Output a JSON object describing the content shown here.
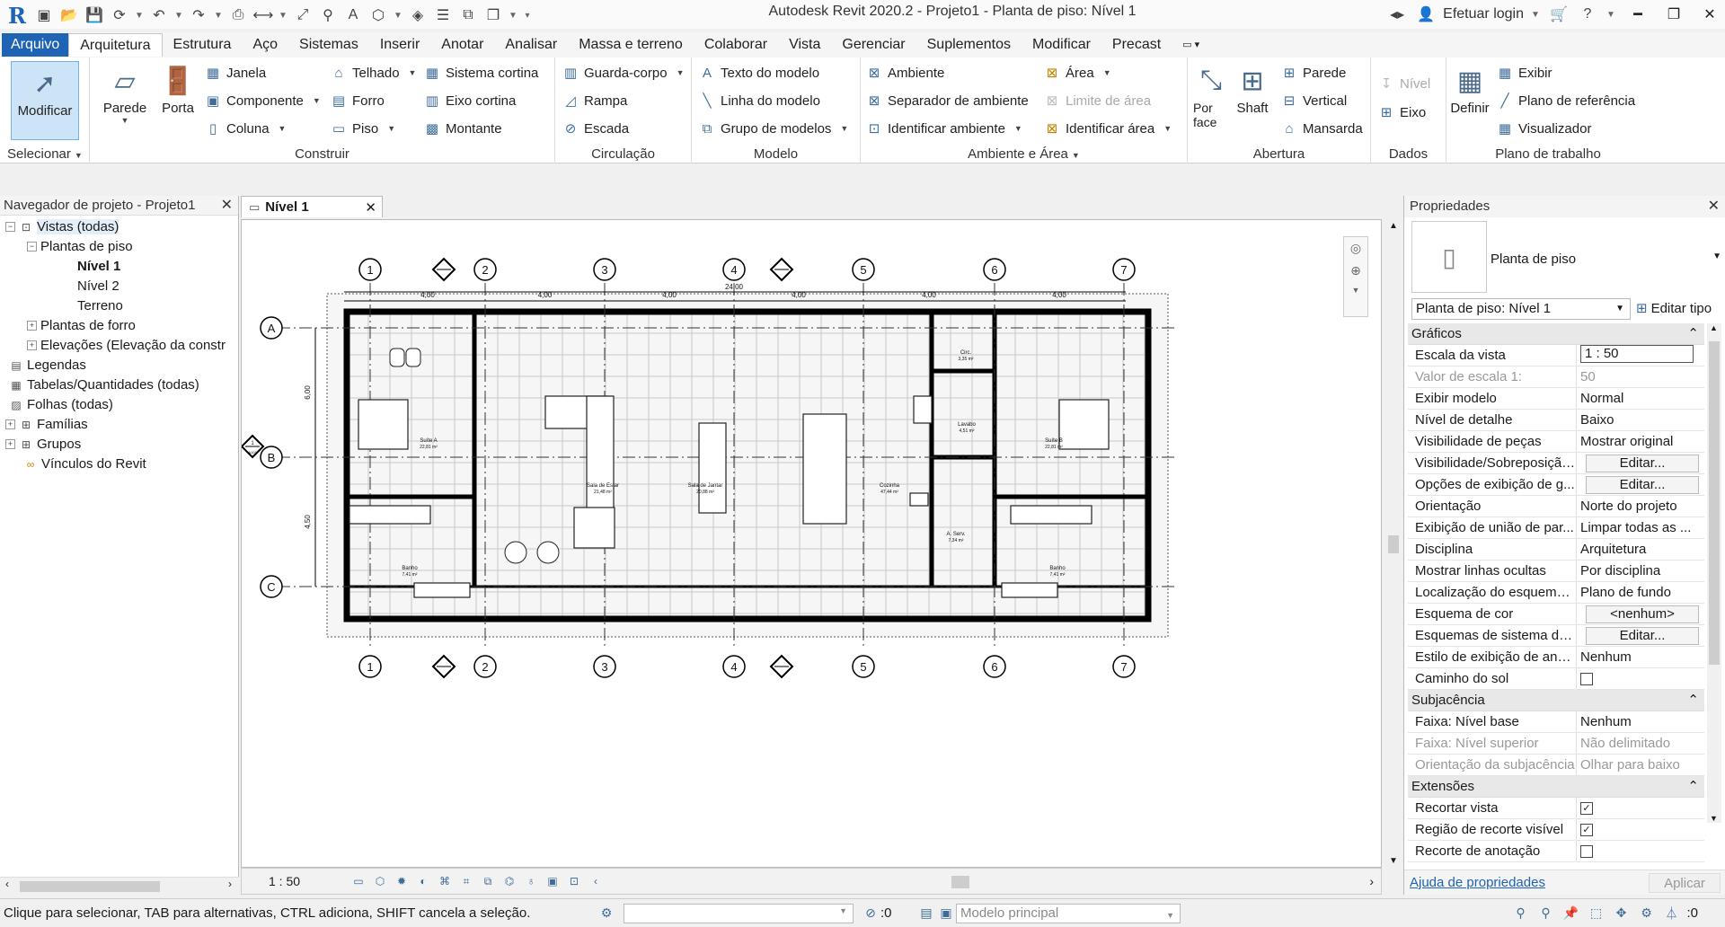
{
  "window": {
    "title": "Autodesk Revit 2020.2 - Projeto1 - Planta de piso: Nível 1",
    "login": "Efetuar login"
  },
  "menu_tabs": [
    "Arquivo",
    "Arquitetura",
    "Estrutura",
    "Aço",
    "Sistemas",
    "Inserir",
    "Anotar",
    "Analisar",
    "Massa e terreno",
    "Colaborar",
    "Vista",
    "Gerenciar",
    "Suplementos",
    "Modificar",
    "Precast"
  ],
  "ribbon": {
    "selecionar": {
      "button": "Modificar",
      "title": "Selecionar"
    },
    "construir": {
      "title": "Construir",
      "parede": "Parede",
      "porta": "Porta",
      "items": [
        "Janela",
        "Componente",
        "Coluna",
        "Telhado",
        "Forro",
        "Piso",
        "Sistema cortina",
        "Eixo cortina",
        "Montante"
      ]
    },
    "circulacao": {
      "title": "Circulação",
      "items": [
        "Guarda-corpo",
        "Rampa",
        "Escada"
      ]
    },
    "modelo": {
      "title": "Modelo",
      "items": [
        "Texto do modelo",
        "Linha do modelo",
        "Grupo de modelos"
      ]
    },
    "ambiente": {
      "title": "Ambiente e Área",
      "items": [
        "Ambiente",
        "Separador de ambiente",
        "Identificar ambiente",
        "Área",
        "Limite de área",
        "Identificar área"
      ]
    },
    "abertura": {
      "title": "Abertura",
      "porface": "Por face",
      "porface_line2": "face",
      "shaft": "Shaft",
      "items": [
        "Parede",
        "Vertical",
        "Mansarda"
      ]
    },
    "dados": {
      "title": "Dados",
      "items": [
        "Nível",
        "Eixo"
      ]
    },
    "plano": {
      "title": "Plano de trabalho",
      "definir": "Definir",
      "items": [
        "Exibir",
        "Plano de referência",
        "Visualizador"
      ]
    }
  },
  "browser": {
    "title": "Navegador de projeto - Projeto1",
    "items": [
      "Vistas (todas)",
      "Plantas de piso",
      "Nível 1",
      "Nível 2",
      "Terreno",
      "Plantas de forro",
      "Elevações (Elevação da constr",
      "Legendas",
      "Tabelas/Quantidades (todas)",
      "Folhas (todas)",
      "Famílias",
      "Grupos",
      "Vínculos do Revit"
    ]
  },
  "view": {
    "tab": "Nível 1",
    "scale": "1 : 50",
    "grid_cols": [
      "1",
      "2",
      "3",
      "4",
      "5",
      "6",
      "7"
    ],
    "grid_rows": [
      "A",
      "B",
      "C"
    ],
    "dims": [
      "4,00",
      "4,00",
      "4,00",
      "4,00",
      "4,00",
      "4,00"
    ],
    "total_dim": "24,00",
    "side_dims": [
      "6,00",
      "4,50"
    ],
    "marker": "1",
    "marker_ref": "A101",
    "rooms": [
      {
        "name": "Suíte A",
        "area": "22,81 m²"
      },
      {
        "name": "Sala de Estar",
        "area": "21,48 m²"
      },
      {
        "name": "Sala de Jantar",
        "area": "20,88 m²"
      },
      {
        "name": "Cozinha",
        "area": "47,44 m²"
      },
      {
        "name": "Lavabo",
        "area": "4,51 m²"
      },
      {
        "name": "Suíte B",
        "area": "22,81 m²"
      },
      {
        "name": "Banho",
        "area": "7,41 m²"
      },
      {
        "name": "A. Serv.",
        "area": "7,34 m²"
      },
      {
        "name": "Banho",
        "area": "7,41 m²"
      },
      {
        "name": "Circ.",
        "area": "3,35 m²"
      }
    ]
  },
  "properties": {
    "title": "Propriedades",
    "type_label": "Planta de piso",
    "selector": "Planta de piso: Nível 1",
    "edit_type": "Editar tipo",
    "groups": [
      {
        "name": "Gráficos",
        "rows": [
          [
            "Escala da vista",
            "1 : 50",
            "input"
          ],
          [
            "Valor de escala    1:",
            "50",
            "disabled"
          ],
          [
            "Exibir modelo",
            "Normal",
            ""
          ],
          [
            "Nível de detalhe",
            "Baixo",
            ""
          ],
          [
            "Visibilidade de peças",
            "Mostrar original",
            ""
          ],
          [
            "Visibilidade/Sobreposição...",
            "Editar...",
            "button"
          ],
          [
            "Opções de exibição de g...",
            "Editar...",
            "button"
          ],
          [
            "Orientação",
            "Norte do projeto",
            ""
          ],
          [
            "Exibição de união de par...",
            "Limpar todas as ...",
            ""
          ],
          [
            "Disciplina",
            "Arquitetura",
            ""
          ],
          [
            "Mostrar linhas ocultas",
            "Por disciplina",
            ""
          ],
          [
            "Localização do esquema ...",
            "Plano de fundo",
            ""
          ],
          [
            "Esquema de cor",
            "<nenhum>",
            "button"
          ],
          [
            "Esquemas de sistema de ...",
            "Editar...",
            "button"
          ],
          [
            "Estilo de exibição de aná...",
            "Nenhum",
            ""
          ],
          [
            "Caminho do sol",
            "",
            "check-off"
          ]
        ]
      },
      {
        "name": "Subjacência",
        "rows": [
          [
            "Faixa: Nível base",
            "Nenhum",
            ""
          ],
          [
            "Faixa: Nível superior",
            "Não delimitado",
            "disabled"
          ],
          [
            "Orientação da subjacência",
            "Olhar para baixo",
            "disabled"
          ]
        ]
      },
      {
        "name": "Extensões",
        "rows": [
          [
            "Recortar vista",
            "",
            "check-on"
          ],
          [
            "Região de recorte visível",
            "",
            "check-on"
          ],
          [
            "Recorte de anotação",
            "",
            "check-off"
          ]
        ]
      }
    ],
    "help_link": "Ajuda de propriedades",
    "apply": "Aplicar"
  },
  "status": {
    "message": "Clique para selecionar, TAB para alternativas, CTRL adiciona, SHIFT cancela a seleção.",
    "counter": ":0",
    "model": "Modelo principal",
    "filter_count": ":0"
  },
  "colors": {
    "accent": "#1e63b4",
    "selection": "#cde4f7"
  }
}
